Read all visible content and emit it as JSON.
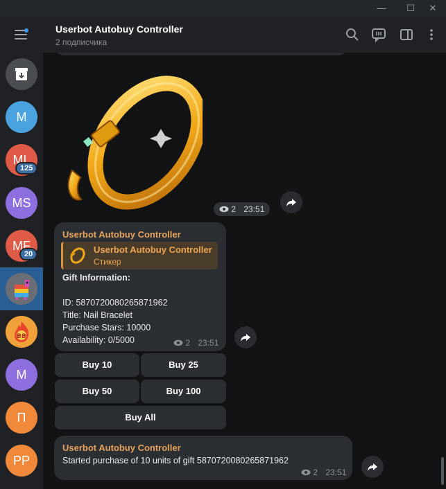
{
  "window_controls": {
    "minimize": "—",
    "maximize": "☐",
    "close": "✕"
  },
  "sidebar": {
    "chats": [
      {
        "name": "archive",
        "initials": "",
        "color": "#4a4d52"
      },
      {
        "name": "chat-m1",
        "initials": "M",
        "color": "#4aa3df"
      },
      {
        "name": "chat-ml",
        "initials": "ML",
        "color": "#e05a48",
        "badge": "125"
      },
      {
        "name": "chat-ms",
        "initials": "MS",
        "color": "#8e6fe0"
      },
      {
        "name": "chat-mf",
        "initials": "MF",
        "color": "#e05a48",
        "badge": "20"
      },
      {
        "name": "chat-pinata",
        "initials": "",
        "color": "#6b6f75"
      },
      {
        "name": "chat-fire",
        "initials": "",
        "color": "#f0a13a"
      },
      {
        "name": "chat-m2",
        "initials": "M",
        "color": "#8e6fe0"
      },
      {
        "name": "chat-p",
        "initials": "П",
        "color": "#f08a3a"
      },
      {
        "name": "chat-pp",
        "initials": "PP",
        "color": "#f08a3a"
      }
    ]
  },
  "header": {
    "title": "Userbot Autobuy Controller",
    "subtitle": "2 подписчика"
  },
  "messages": {
    "sticker": {
      "views": "2",
      "time": "23:51"
    },
    "gift": {
      "sender": "Userbot Autobuy Controller",
      "reply_name": "Userbot Autobuy Controller",
      "reply_sub": "Стикер",
      "heading": "Gift Information:",
      "lines": [
        "ID: 5870720080265871962",
        "Title: Nail Bracelet",
        "Purchase Stars: 10000",
        "Availability: 0/5000"
      ],
      "views": "2",
      "time": "23:51"
    },
    "keyboard": {
      "buy10": "Buy 10",
      "buy25": "Buy 25",
      "buy50": "Buy 50",
      "buy100": "Buy 100",
      "buyall": "Buy All"
    },
    "status": {
      "sender": "Userbot Autobuy Controller",
      "text": "Started purchase of 10 units of gift 5870720080265871962",
      "views": "2",
      "time": "23:51"
    }
  },
  "colors": {
    "accent": "#e8a45a",
    "active_chat": "#2a5f95",
    "bubble": "#2b2e33"
  }
}
